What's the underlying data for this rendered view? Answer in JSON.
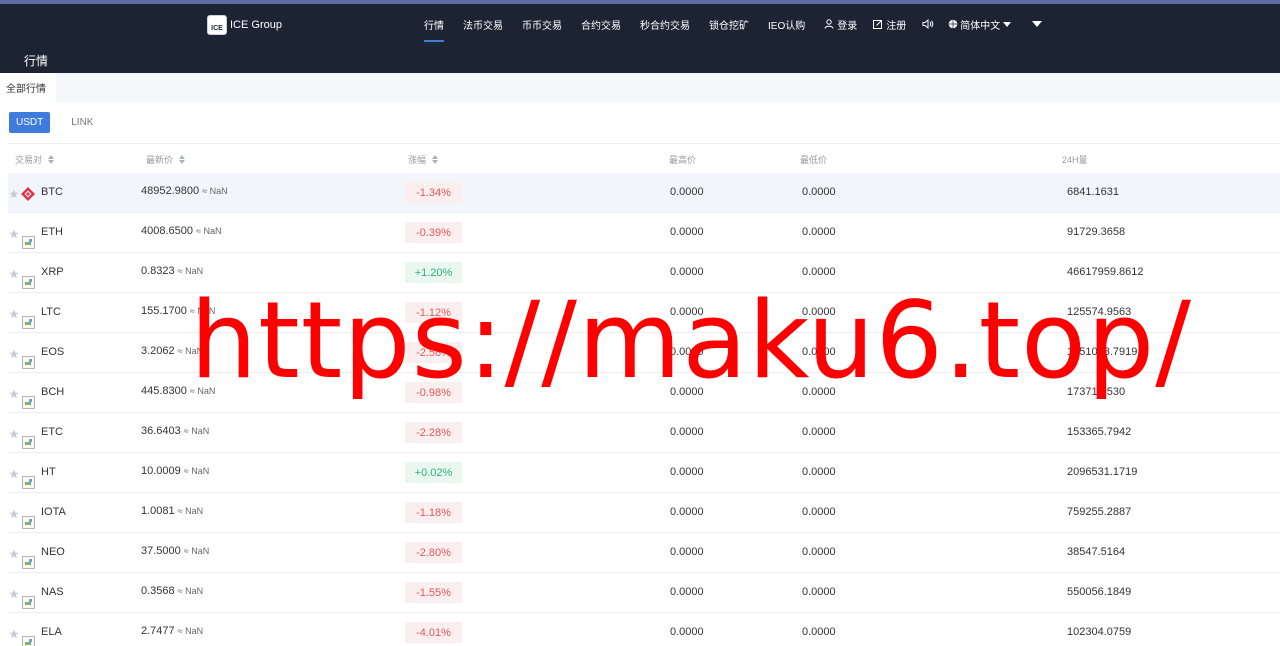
{
  "brand": {
    "logo_text": "ICE Group",
    "logo_mark": "ICE"
  },
  "nav": {
    "links": [
      "行情",
      "法币交易",
      "币币交易",
      "合约交易",
      "秒合约交易",
      "锁仓挖矿",
      "IEO认购"
    ],
    "active_index": 0,
    "login": "登录",
    "register": "注册",
    "language": "简体中文"
  },
  "page_title": "行情",
  "tabs": {
    "all": "全部行情"
  },
  "currencies": [
    "USDT",
    "LINK"
  ],
  "table": {
    "headers": [
      "交易对",
      "最新价",
      "涨幅",
      "最高价",
      "最低价",
      "24H量"
    ],
    "rows": [
      {
        "symbol": "BTC",
        "price": "48952.9800",
        "approx": "≈ NaN",
        "change": "-1.34%",
        "direction": "down",
        "high": "0.0000",
        "low": "0.0000",
        "volume": "6841.1631"
      },
      {
        "symbol": "ETH",
        "price": "4008.6500",
        "approx": "≈ NaN",
        "change": "-0.39%",
        "direction": "down",
        "high": "0.0000",
        "low": "0.0000",
        "volume": "91729.3658"
      },
      {
        "symbol": "XRP",
        "price": "0.8323",
        "approx": "≈ NaN",
        "change": "+1.20%",
        "direction": "up",
        "high": "0.0000",
        "low": "0.0000",
        "volume": "46617959.8612"
      },
      {
        "symbol": "LTC",
        "price": "155.1700",
        "approx": "≈ NaN",
        "change": "-1.12%",
        "direction": "down",
        "high": "0.0000",
        "low": "0.0000",
        "volume": "125574.9563"
      },
      {
        "symbol": "EOS",
        "price": "3.2062",
        "approx": "≈ NaN",
        "change": "-2.58%",
        "direction": "down",
        "high": "0.0000",
        "low": "0.0000",
        "volume": "1351008.7919"
      },
      {
        "symbol": "BCH",
        "price": "445.8300",
        "approx": "≈ NaN",
        "change": "-0.98%",
        "direction": "down",
        "high": "0.0000",
        "low": "0.0000",
        "volume": "17371.1530"
      },
      {
        "symbol": "ETC",
        "price": "36.6403",
        "approx": "≈ NaN",
        "change": "-2.28%",
        "direction": "down",
        "high": "0.0000",
        "low": "0.0000",
        "volume": "153365.7942"
      },
      {
        "symbol": "HT",
        "price": "10.0009",
        "approx": "≈ NaN",
        "change": "+0.02%",
        "direction": "up",
        "high": "0.0000",
        "low": "0.0000",
        "volume": "2096531.1719"
      },
      {
        "symbol": "IOTA",
        "price": "1.0081",
        "approx": "≈ NaN",
        "change": "-1.18%",
        "direction": "down",
        "high": "0.0000",
        "low": "0.0000",
        "volume": "759255.2887"
      },
      {
        "symbol": "NEO",
        "price": "37.5000",
        "approx": "≈ NaN",
        "change": "-2.80%",
        "direction": "down",
        "high": "0.0000",
        "low": "0.0000",
        "volume": "38547.5164"
      },
      {
        "symbol": "NAS",
        "price": "0.3568",
        "approx": "≈ NaN",
        "change": "-1.55%",
        "direction": "down",
        "high": "0.0000",
        "low": "0.0000",
        "volume": "550056.1849"
      },
      {
        "symbol": "ELA",
        "price": "2.7477",
        "approx": "≈ NaN",
        "change": "-4.01%",
        "direction": "down",
        "high": "0.0000",
        "low": "0.0000",
        "volume": "102304.0759"
      }
    ]
  },
  "watermark": "https://maku6.top/",
  "colors": {
    "accent": "#3d7bdc",
    "nav_bg": "#1c2433",
    "down": "#e4575a",
    "up": "#2db07a",
    "watermark": "#ff0000"
  }
}
